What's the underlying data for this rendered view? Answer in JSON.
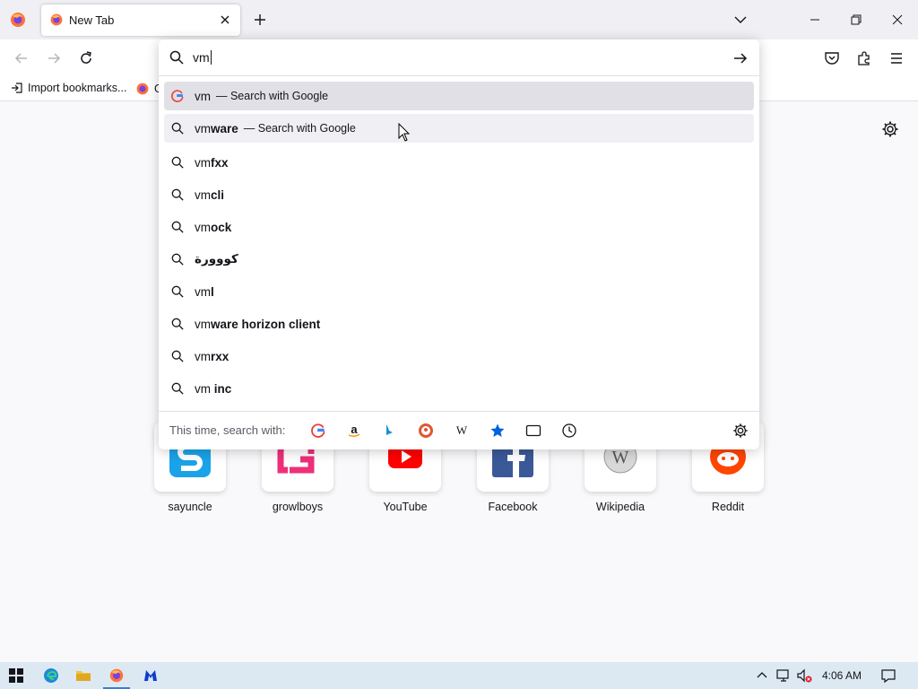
{
  "tab": {
    "title": "New Tab"
  },
  "urlbar": {
    "typed": "vm"
  },
  "bookmarks": [
    {
      "label": "Import bookmarks..."
    },
    {
      "label": "G"
    }
  ],
  "results": [
    {
      "prefix": "vm",
      "bold": "",
      "action": "— Search with Google",
      "icon": "google-icon",
      "state": "selected"
    },
    {
      "prefix": "vm",
      "bold": "ware",
      "action": "— Search with Google",
      "icon": "search-icon",
      "state": "hover"
    },
    {
      "prefix": "vm",
      "bold": "fxx",
      "action": "",
      "icon": "search-icon"
    },
    {
      "prefix": "vm",
      "bold": "cli",
      "action": "",
      "icon": "search-icon"
    },
    {
      "prefix": "vm",
      "bold": "ock",
      "action": "",
      "icon": "search-icon"
    },
    {
      "prefix": "",
      "bold": "كووورة",
      "action": "",
      "icon": "search-icon"
    },
    {
      "prefix": "vm",
      "bold": "l",
      "action": "",
      "icon": "search-icon"
    },
    {
      "prefix": "vm",
      "bold": "ware horizon client",
      "action": "",
      "icon": "search-icon"
    },
    {
      "prefix": "vm",
      "bold": "rxx",
      "action": "",
      "icon": "search-icon"
    },
    {
      "prefix": "vm ",
      "bold": "inc",
      "action": "",
      "icon": "search-icon"
    }
  ],
  "oneoff": {
    "label": "This time, search with:",
    "engines": [
      "google-icon",
      "amazon-icon",
      "bing-icon",
      "duckduckgo-icon",
      "wikipedia-icon",
      "bookmarks-star-icon",
      "tabs-icon",
      "history-icon"
    ]
  },
  "topsites": [
    {
      "label": "sayuncle",
      "icon": "sayuncle-logo",
      "color": "#1aa3e8"
    },
    {
      "label": "growlboys",
      "icon": "growlboys-logo",
      "color": "#ee2f7a"
    },
    {
      "label": "YouTube",
      "icon": "youtube-logo",
      "color": "#ff0000"
    },
    {
      "label": "Facebook",
      "icon": "facebook-logo",
      "color": "#3b5998"
    },
    {
      "label": "Wikipedia",
      "icon": "wikipedia-logo",
      "color": "#9a9a9a"
    },
    {
      "label": "Reddit",
      "icon": "reddit-logo",
      "color": "#ff4500"
    }
  ],
  "taskbar": {
    "time": "4:06 AM"
  },
  "colors": {
    "accent": "#0061e0",
    "tab_strip": "#f0f0f4",
    "taskbar": "#dce9f3"
  }
}
